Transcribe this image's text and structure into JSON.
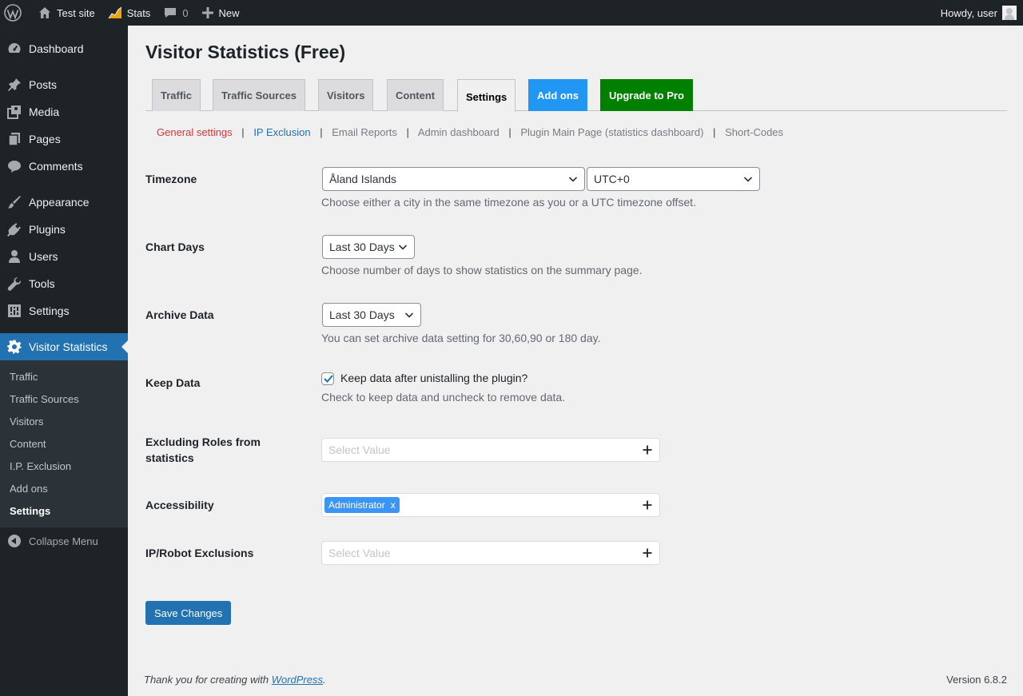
{
  "adminbar": {
    "site_name": "Test site",
    "stats": "Stats",
    "comments_count": "0",
    "new": "New",
    "howdy": "Howdy, user"
  },
  "sidebar": {
    "items": [
      {
        "label": "Dashboard",
        "icon": "dashboard-icon"
      },
      {
        "label": "Posts",
        "icon": "pin-icon"
      },
      {
        "label": "Media",
        "icon": "media-icon"
      },
      {
        "label": "Pages",
        "icon": "pages-icon"
      },
      {
        "label": "Comments",
        "icon": "comment-icon"
      },
      {
        "label": "Appearance",
        "icon": "brush-icon"
      },
      {
        "label": "Plugins",
        "icon": "plug-icon"
      },
      {
        "label": "Users",
        "icon": "user-icon"
      },
      {
        "label": "Tools",
        "icon": "wrench-icon"
      },
      {
        "label": "Settings",
        "icon": "sliders-icon"
      },
      {
        "label": "Visitor Statistics",
        "icon": "gear-icon"
      }
    ],
    "submenu": [
      "Traffic",
      "Traffic Sources",
      "Visitors",
      "Content",
      "I.P. Exclusion",
      "Add ons",
      "Settings"
    ],
    "collapse": "Collapse Menu"
  },
  "page": {
    "title": "Visitor Statistics (Free)",
    "tabs": [
      "Traffic",
      "Traffic Sources",
      "Visitors",
      "Content",
      "Settings",
      "Add ons",
      "Upgrade to Pro"
    ],
    "subnav": [
      "General settings",
      "IP Exclusion",
      "Email Reports",
      "Admin dashboard",
      "Plugin Main Page (statistics dashboard)",
      "Short-Codes"
    ],
    "subnav_sep": "|"
  },
  "form": {
    "timezone": {
      "label": "Timezone",
      "city": "Åland Islands",
      "offset": "UTC+0",
      "desc": "Choose either a city in the same timezone as you or a UTC timezone offset."
    },
    "chart_days": {
      "label": "Chart Days",
      "value": "Last 30 Days",
      "desc": "Choose number of days to show statistics on the summary page."
    },
    "archive": {
      "label": "Archive Data",
      "value": "Last 30 Days",
      "desc": "You can set archive data setting for 30,60,90 or 180 day."
    },
    "keep": {
      "label": "Keep Data",
      "checkbox_label": "Keep data after unistalling the plugin?",
      "desc": "Check to keep data and uncheck to remove data."
    },
    "excluding_roles": {
      "label": "Excluding Roles from statistics",
      "placeholder": "Select Value"
    },
    "accessibility": {
      "label": "Accessibility",
      "tag": "Administrator",
      "tag_remove": "x"
    },
    "ip_robot": {
      "label": "IP/Robot Exclusions",
      "placeholder": "Select Value"
    },
    "save": "Save Changes"
  },
  "footer": {
    "thanks_prefix": "Thank you for creating with ",
    "wp_link": "WordPress",
    "thanks_suffix": ".",
    "version": "Version 6.8.2"
  },
  "colors": {
    "adminbar_bg": "#1d2327",
    "accent": "#2271b1",
    "addons_tab": "#2196f3",
    "pro_tab": "#008000",
    "subnav_current": "#d63638"
  }
}
